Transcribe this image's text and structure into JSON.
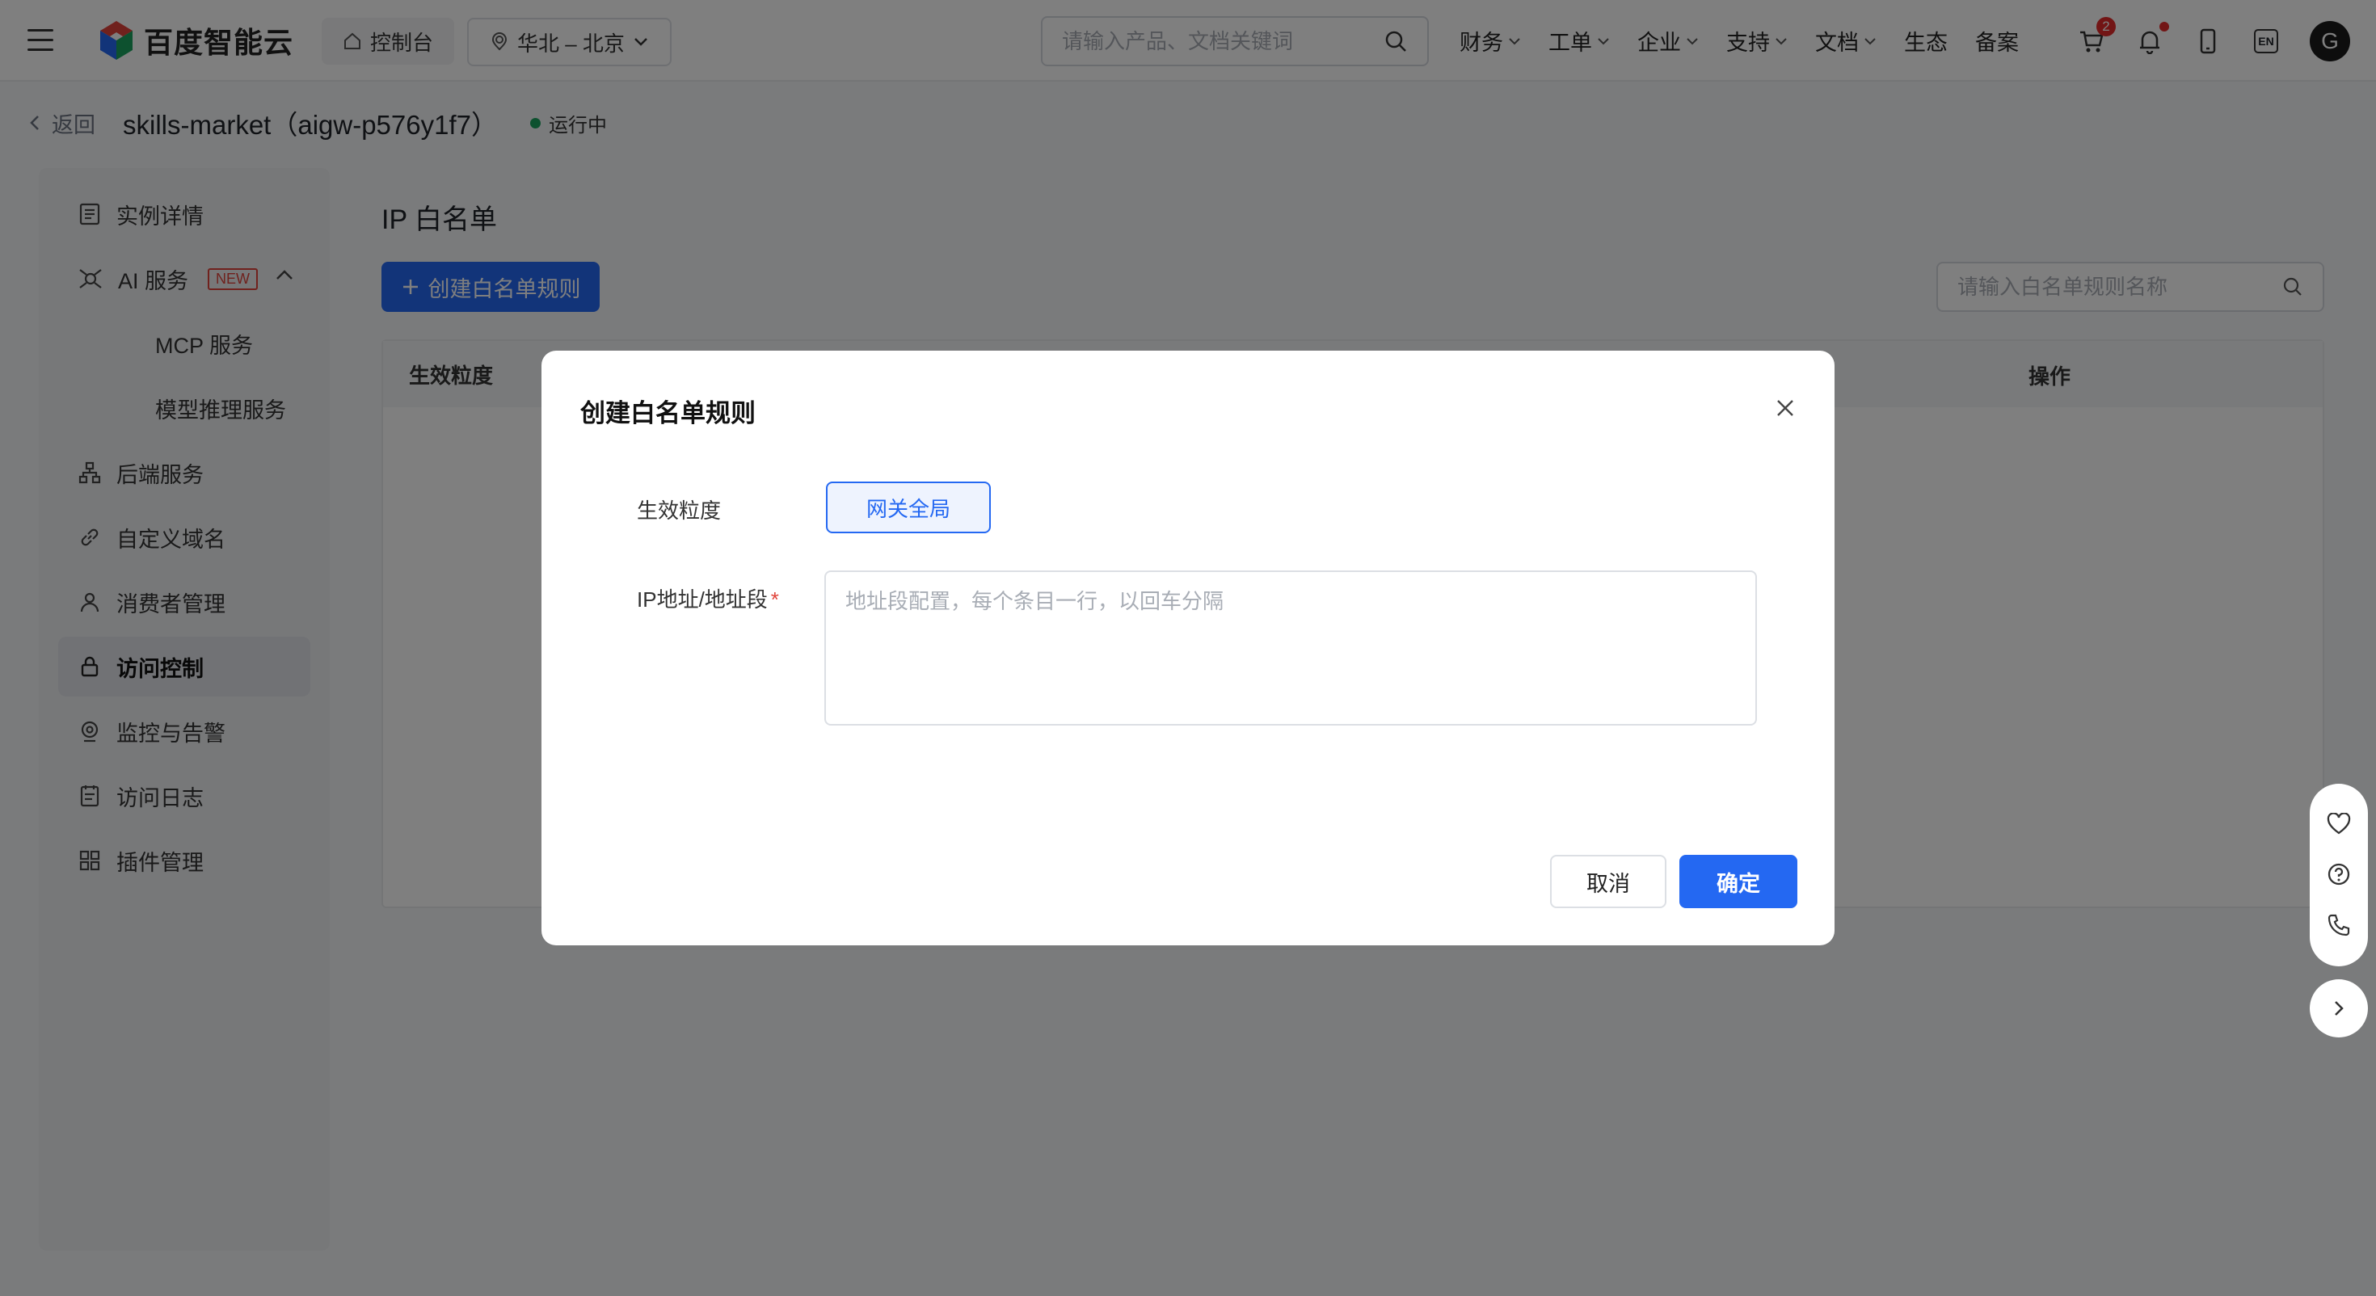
{
  "topnav": {
    "logo_text": "百度智能云",
    "console_label": "控制台",
    "region_label": "华北 – 北京",
    "search_placeholder": "请输入产品、文档关键词",
    "menu": [
      {
        "label": "财务",
        "has_dropdown": true
      },
      {
        "label": "工单",
        "has_dropdown": true
      },
      {
        "label": "企业",
        "has_dropdown": true
      },
      {
        "label": "支持",
        "has_dropdown": true
      },
      {
        "label": "文档",
        "has_dropdown": true
      },
      {
        "label": "生态",
        "has_dropdown": false
      },
      {
        "label": "备案",
        "has_dropdown": false
      }
    ],
    "cart_count": "2",
    "lang_label": "EN",
    "avatar_initial": "G"
  },
  "header": {
    "back_label": "返回",
    "title": "skills-market（aigw-p576y1f7）",
    "status": "运行中",
    "status_color": "#1aa35f"
  },
  "sidebar": {
    "items": [
      {
        "label": "实例详情",
        "icon": "document-list-icon"
      },
      {
        "label": "AI 服务",
        "icon": "ai-service-icon",
        "tag": "NEW"
      },
      {
        "label": "MCP 服务"
      },
      {
        "label": "模型推理服务"
      },
      {
        "label": "后端服务",
        "icon": "org-tree-icon"
      },
      {
        "label": "自定义域名",
        "icon": "link-icon"
      },
      {
        "label": "消费者管理",
        "icon": "user-icon"
      },
      {
        "label": "访问控制",
        "icon": "lock-icon",
        "active": true
      },
      {
        "label": "监控与告警",
        "icon": "monitor-icon"
      },
      {
        "label": "访问日志",
        "icon": "log-icon"
      },
      {
        "label": "插件管理",
        "icon": "grid-icon"
      }
    ]
  },
  "main": {
    "title": "IP 白名单",
    "create_button": "创建白名单规则",
    "search_placeholder": "请输入白名单规则名称",
    "table_headers": {
      "granularity": "生效粒度",
      "action": "操作"
    }
  },
  "modal": {
    "title": "创建白名单规则",
    "granularity_label": "生效粒度",
    "granularity_value": "网关全局",
    "ip_label": "IP地址/地址段",
    "ip_placeholder": "地址段配置，每个条目一行，以回车分隔",
    "cancel_label": "取消",
    "confirm_label": "确定"
  },
  "colors": {
    "primary": "#2468f2",
    "danger": "#e0433a"
  }
}
